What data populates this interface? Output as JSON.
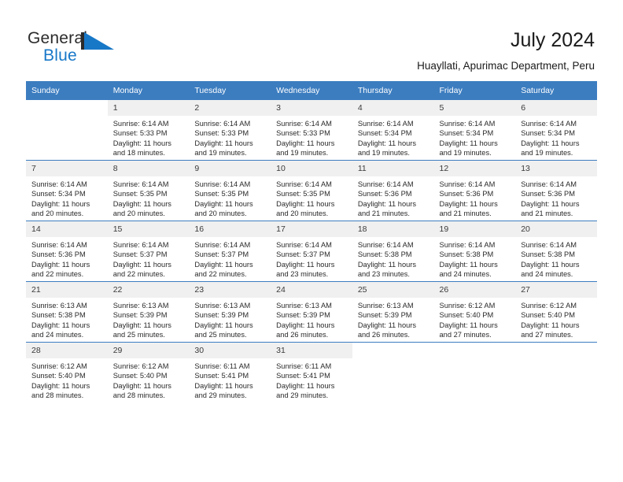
{
  "brand": {
    "name_part1": "General",
    "name_part2": "Blue",
    "triangle_color": "#1878c8",
    "text_color": "#2b2b2b"
  },
  "header": {
    "title": "July 2024",
    "subtitle": "Huayllati, Apurimac Department, Peru"
  },
  "theme": {
    "header_blue": "#3c7dc0",
    "daynum_gray": "#f0f0f0"
  },
  "calendar": {
    "weekdays": [
      "Sunday",
      "Monday",
      "Tuesday",
      "Wednesday",
      "Thursday",
      "Friday",
      "Saturday"
    ],
    "weeks": [
      [
        {
          "day": "",
          "sunrise": "",
          "sunset": "",
          "daylight1": "",
          "daylight2": ""
        },
        {
          "day": "1",
          "sunrise": "Sunrise: 6:14 AM",
          "sunset": "Sunset: 5:33 PM",
          "daylight1": "Daylight: 11 hours",
          "daylight2": "and 18 minutes."
        },
        {
          "day": "2",
          "sunrise": "Sunrise: 6:14 AM",
          "sunset": "Sunset: 5:33 PM",
          "daylight1": "Daylight: 11 hours",
          "daylight2": "and 19 minutes."
        },
        {
          "day": "3",
          "sunrise": "Sunrise: 6:14 AM",
          "sunset": "Sunset: 5:33 PM",
          "daylight1": "Daylight: 11 hours",
          "daylight2": "and 19 minutes."
        },
        {
          "day": "4",
          "sunrise": "Sunrise: 6:14 AM",
          "sunset": "Sunset: 5:34 PM",
          "daylight1": "Daylight: 11 hours",
          "daylight2": "and 19 minutes."
        },
        {
          "day": "5",
          "sunrise": "Sunrise: 6:14 AM",
          "sunset": "Sunset: 5:34 PM",
          "daylight1": "Daylight: 11 hours",
          "daylight2": "and 19 minutes."
        },
        {
          "day": "6",
          "sunrise": "Sunrise: 6:14 AM",
          "sunset": "Sunset: 5:34 PM",
          "daylight1": "Daylight: 11 hours",
          "daylight2": "and 19 minutes."
        }
      ],
      [
        {
          "day": "7",
          "sunrise": "Sunrise: 6:14 AM",
          "sunset": "Sunset: 5:34 PM",
          "daylight1": "Daylight: 11 hours",
          "daylight2": "and 20 minutes."
        },
        {
          "day": "8",
          "sunrise": "Sunrise: 6:14 AM",
          "sunset": "Sunset: 5:35 PM",
          "daylight1": "Daylight: 11 hours",
          "daylight2": "and 20 minutes."
        },
        {
          "day": "9",
          "sunrise": "Sunrise: 6:14 AM",
          "sunset": "Sunset: 5:35 PM",
          "daylight1": "Daylight: 11 hours",
          "daylight2": "and 20 minutes."
        },
        {
          "day": "10",
          "sunrise": "Sunrise: 6:14 AM",
          "sunset": "Sunset: 5:35 PM",
          "daylight1": "Daylight: 11 hours",
          "daylight2": "and 20 minutes."
        },
        {
          "day": "11",
          "sunrise": "Sunrise: 6:14 AM",
          "sunset": "Sunset: 5:36 PM",
          "daylight1": "Daylight: 11 hours",
          "daylight2": "and 21 minutes."
        },
        {
          "day": "12",
          "sunrise": "Sunrise: 6:14 AM",
          "sunset": "Sunset: 5:36 PM",
          "daylight1": "Daylight: 11 hours",
          "daylight2": "and 21 minutes."
        },
        {
          "day": "13",
          "sunrise": "Sunrise: 6:14 AM",
          "sunset": "Sunset: 5:36 PM",
          "daylight1": "Daylight: 11 hours",
          "daylight2": "and 21 minutes."
        }
      ],
      [
        {
          "day": "14",
          "sunrise": "Sunrise: 6:14 AM",
          "sunset": "Sunset: 5:36 PM",
          "daylight1": "Daylight: 11 hours",
          "daylight2": "and 22 minutes."
        },
        {
          "day": "15",
          "sunrise": "Sunrise: 6:14 AM",
          "sunset": "Sunset: 5:37 PM",
          "daylight1": "Daylight: 11 hours",
          "daylight2": "and 22 minutes."
        },
        {
          "day": "16",
          "sunrise": "Sunrise: 6:14 AM",
          "sunset": "Sunset: 5:37 PM",
          "daylight1": "Daylight: 11 hours",
          "daylight2": "and 22 minutes."
        },
        {
          "day": "17",
          "sunrise": "Sunrise: 6:14 AM",
          "sunset": "Sunset: 5:37 PM",
          "daylight1": "Daylight: 11 hours",
          "daylight2": "and 23 minutes."
        },
        {
          "day": "18",
          "sunrise": "Sunrise: 6:14 AM",
          "sunset": "Sunset: 5:38 PM",
          "daylight1": "Daylight: 11 hours",
          "daylight2": "and 23 minutes."
        },
        {
          "day": "19",
          "sunrise": "Sunrise: 6:14 AM",
          "sunset": "Sunset: 5:38 PM",
          "daylight1": "Daylight: 11 hours",
          "daylight2": "and 24 minutes."
        },
        {
          "day": "20",
          "sunrise": "Sunrise: 6:14 AM",
          "sunset": "Sunset: 5:38 PM",
          "daylight1": "Daylight: 11 hours",
          "daylight2": "and 24 minutes."
        }
      ],
      [
        {
          "day": "21",
          "sunrise": "Sunrise: 6:13 AM",
          "sunset": "Sunset: 5:38 PM",
          "daylight1": "Daylight: 11 hours",
          "daylight2": "and 24 minutes."
        },
        {
          "day": "22",
          "sunrise": "Sunrise: 6:13 AM",
          "sunset": "Sunset: 5:39 PM",
          "daylight1": "Daylight: 11 hours",
          "daylight2": "and 25 minutes."
        },
        {
          "day": "23",
          "sunrise": "Sunrise: 6:13 AM",
          "sunset": "Sunset: 5:39 PM",
          "daylight1": "Daylight: 11 hours",
          "daylight2": "and 25 minutes."
        },
        {
          "day": "24",
          "sunrise": "Sunrise: 6:13 AM",
          "sunset": "Sunset: 5:39 PM",
          "daylight1": "Daylight: 11 hours",
          "daylight2": "and 26 minutes."
        },
        {
          "day": "25",
          "sunrise": "Sunrise: 6:13 AM",
          "sunset": "Sunset: 5:39 PM",
          "daylight1": "Daylight: 11 hours",
          "daylight2": "and 26 minutes."
        },
        {
          "day": "26",
          "sunrise": "Sunrise: 6:12 AM",
          "sunset": "Sunset: 5:40 PM",
          "daylight1": "Daylight: 11 hours",
          "daylight2": "and 27 minutes."
        },
        {
          "day": "27",
          "sunrise": "Sunrise: 6:12 AM",
          "sunset": "Sunset: 5:40 PM",
          "daylight1": "Daylight: 11 hours",
          "daylight2": "and 27 minutes."
        }
      ],
      [
        {
          "day": "28",
          "sunrise": "Sunrise: 6:12 AM",
          "sunset": "Sunset: 5:40 PM",
          "daylight1": "Daylight: 11 hours",
          "daylight2": "and 28 minutes."
        },
        {
          "day": "29",
          "sunrise": "Sunrise: 6:12 AM",
          "sunset": "Sunset: 5:40 PM",
          "daylight1": "Daylight: 11 hours",
          "daylight2": "and 28 minutes."
        },
        {
          "day": "30",
          "sunrise": "Sunrise: 6:11 AM",
          "sunset": "Sunset: 5:41 PM",
          "daylight1": "Daylight: 11 hours",
          "daylight2": "and 29 minutes."
        },
        {
          "day": "31",
          "sunrise": "Sunrise: 6:11 AM",
          "sunset": "Sunset: 5:41 PM",
          "daylight1": "Daylight: 11 hours",
          "daylight2": "and 29 minutes."
        },
        {
          "day": "",
          "sunrise": "",
          "sunset": "",
          "daylight1": "",
          "daylight2": ""
        },
        {
          "day": "",
          "sunrise": "",
          "sunset": "",
          "daylight1": "",
          "daylight2": ""
        },
        {
          "day": "",
          "sunrise": "",
          "sunset": "",
          "daylight1": "",
          "daylight2": ""
        }
      ]
    ]
  }
}
